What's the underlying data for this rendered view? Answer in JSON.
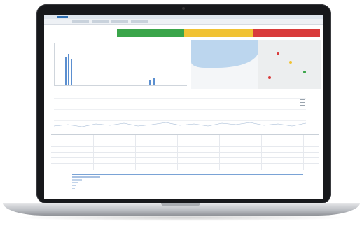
{
  "colors": {
    "status_green": "#3aa54a",
    "status_yellow": "#f1c232",
    "status_red": "#d93b3b",
    "accent_blue": "#2f6fb2",
    "bar_blue": "#5b8fd0",
    "map_water": "#bcd6ee"
  },
  "icons": [
    "logo-mark",
    "map-pin-icon"
  ]
}
